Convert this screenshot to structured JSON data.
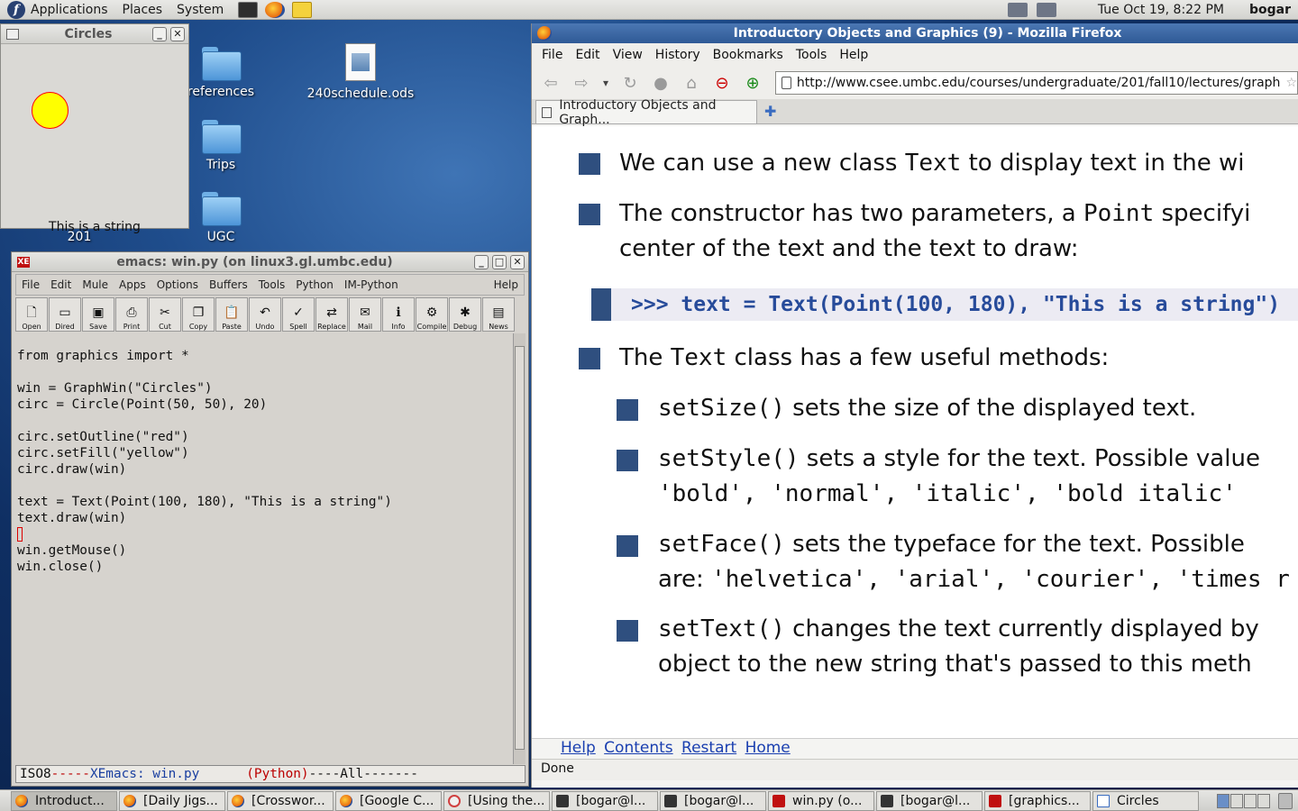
{
  "top_panel": {
    "menus": [
      "Applications",
      "Places",
      "System"
    ],
    "clock": "Tue Oct 19,  8:22 PM",
    "user": "bogar"
  },
  "desktop_icons": [
    {
      "label": "references",
      "icon": "folder-icon"
    },
    {
      "label": "240schedule.ods",
      "icon": "spreadsheet-icon"
    },
    {
      "label": "Trips",
      "icon": "folder-icon"
    },
    {
      "label": "201",
      "icon": "folder-icon"
    },
    {
      "label": "UGC",
      "icon": "folder-icon"
    }
  ],
  "circles_window": {
    "title": "Circles",
    "text": "This is a string",
    "circle_fill": "#ffff00",
    "circle_outline": "#ff0000"
  },
  "emacs": {
    "title": "emacs: win.py (on linux3.gl.umbc.edu)",
    "menu": [
      "File",
      "Edit",
      "Mule",
      "Apps",
      "Options",
      "Buffers",
      "Tools",
      "Python",
      "IM-Python"
    ],
    "help": "Help",
    "toolbar": [
      {
        "label": "Open",
        "icon": "open-file-icon"
      },
      {
        "label": "Dired",
        "icon": "folder-icon"
      },
      {
        "label": "Save",
        "icon": "save-icon"
      },
      {
        "label": "Print",
        "icon": "print-icon"
      },
      {
        "label": "Cut",
        "icon": "scissors-icon"
      },
      {
        "label": "Copy",
        "icon": "copy-icon"
      },
      {
        "label": "Paste",
        "icon": "paste-icon"
      },
      {
        "label": "Undo",
        "icon": "undo-icon"
      },
      {
        "label": "Spell",
        "icon": "spell-icon"
      },
      {
        "label": "Replace",
        "icon": "replace-icon"
      },
      {
        "label": "Mail",
        "icon": "mail-icon"
      },
      {
        "label": "Info",
        "icon": "info-icon"
      },
      {
        "label": "Compile",
        "icon": "compile-icon"
      },
      {
        "label": "Debug",
        "icon": "debug-icon"
      },
      {
        "label": "News",
        "icon": "news-icon"
      }
    ],
    "code": [
      "from graphics import *",
      "",
      "win = GraphWin(\"Circles\")",
      "circ = Circle(Point(50, 50), 20)",
      "",
      "circ.setOutline(\"red\")",
      "circ.setFill(\"yellow\")",
      "circ.draw(win)",
      "",
      "text = Text(Point(100, 180), \"This is a string\")",
      "text.draw(win)",
      "",
      "win.getMouse()",
      "win.close()"
    ],
    "modeline": {
      "encoding": "ISO8",
      "dashes1": "-----",
      "buffer": "XEmacs: win.py",
      "mode": "(Python)",
      "rest": "----All-------"
    }
  },
  "firefox": {
    "title": "Introductory Objects and Graphics (9) - Mozilla Firefox",
    "menu": [
      "File",
      "Edit",
      "View",
      "History",
      "Bookmarks",
      "Tools",
      "Help"
    ],
    "url": "http://www.csee.umbc.edu/courses/undergraduate/201/fall10/lectures/graph",
    "tab_title": "Introductory Objects and Graph...",
    "content": {
      "b1": {
        "pre": "We can use a new class ",
        "code": "Text",
        "post": " to display text in the wi"
      },
      "b2_line1": {
        "pre": "The constructor has two parameters, a ",
        "code": "Point",
        "post": " specifyi"
      },
      "b2_line2": "center of the text and the text to draw:",
      "code_example": ">>> text = Text(Point(100, 180), \"This is a string\")",
      "b3": {
        "pre": "The ",
        "code": "Text",
        "post": " class has a few useful methods:"
      },
      "sub1": {
        "code": "setSize()",
        "post": " sets the size of the displayed text."
      },
      "sub2_line1": {
        "code": "setStyle()",
        "post": " sets a style for the text. Possible value"
      },
      "sub2_line2": "'bold', 'normal', 'italic', 'bold italic'",
      "sub3_line1": {
        "code": "setFace()",
        "post": " sets the typeface for the text. Possible"
      },
      "sub3_line2": {
        "pre": "are: ",
        "code": "'helvetica', 'arial', 'courier', 'times r"
      },
      "sub4_line1": {
        "code": "setText()",
        "post": " changes the text currently displayed by"
      },
      "sub4_line2": "object to the new string that's passed to this meth"
    },
    "footer_links": [
      "Help",
      "Contents",
      "Restart",
      "Home"
    ],
    "status": "Done"
  },
  "taskbar": [
    {
      "label": "Introduct...",
      "icon": "ff",
      "active": true
    },
    {
      "label": "[Daily Jigs...",
      "icon": "ff"
    },
    {
      "label": "[Crosswor...",
      "icon": "ff"
    },
    {
      "label": "[Google C...",
      "icon": "ff"
    },
    {
      "label": "[Using the...",
      "icon": "help"
    },
    {
      "label": "[bogar@l...",
      "icon": "term"
    },
    {
      "label": "[bogar@l...",
      "icon": "term"
    },
    {
      "label": "win.py (o...",
      "icon": "xe"
    },
    {
      "label": "[bogar@l...",
      "icon": "term"
    },
    {
      "label": "[graphics...",
      "icon": "xe"
    },
    {
      "label": "Circles",
      "icon": "win"
    }
  ]
}
